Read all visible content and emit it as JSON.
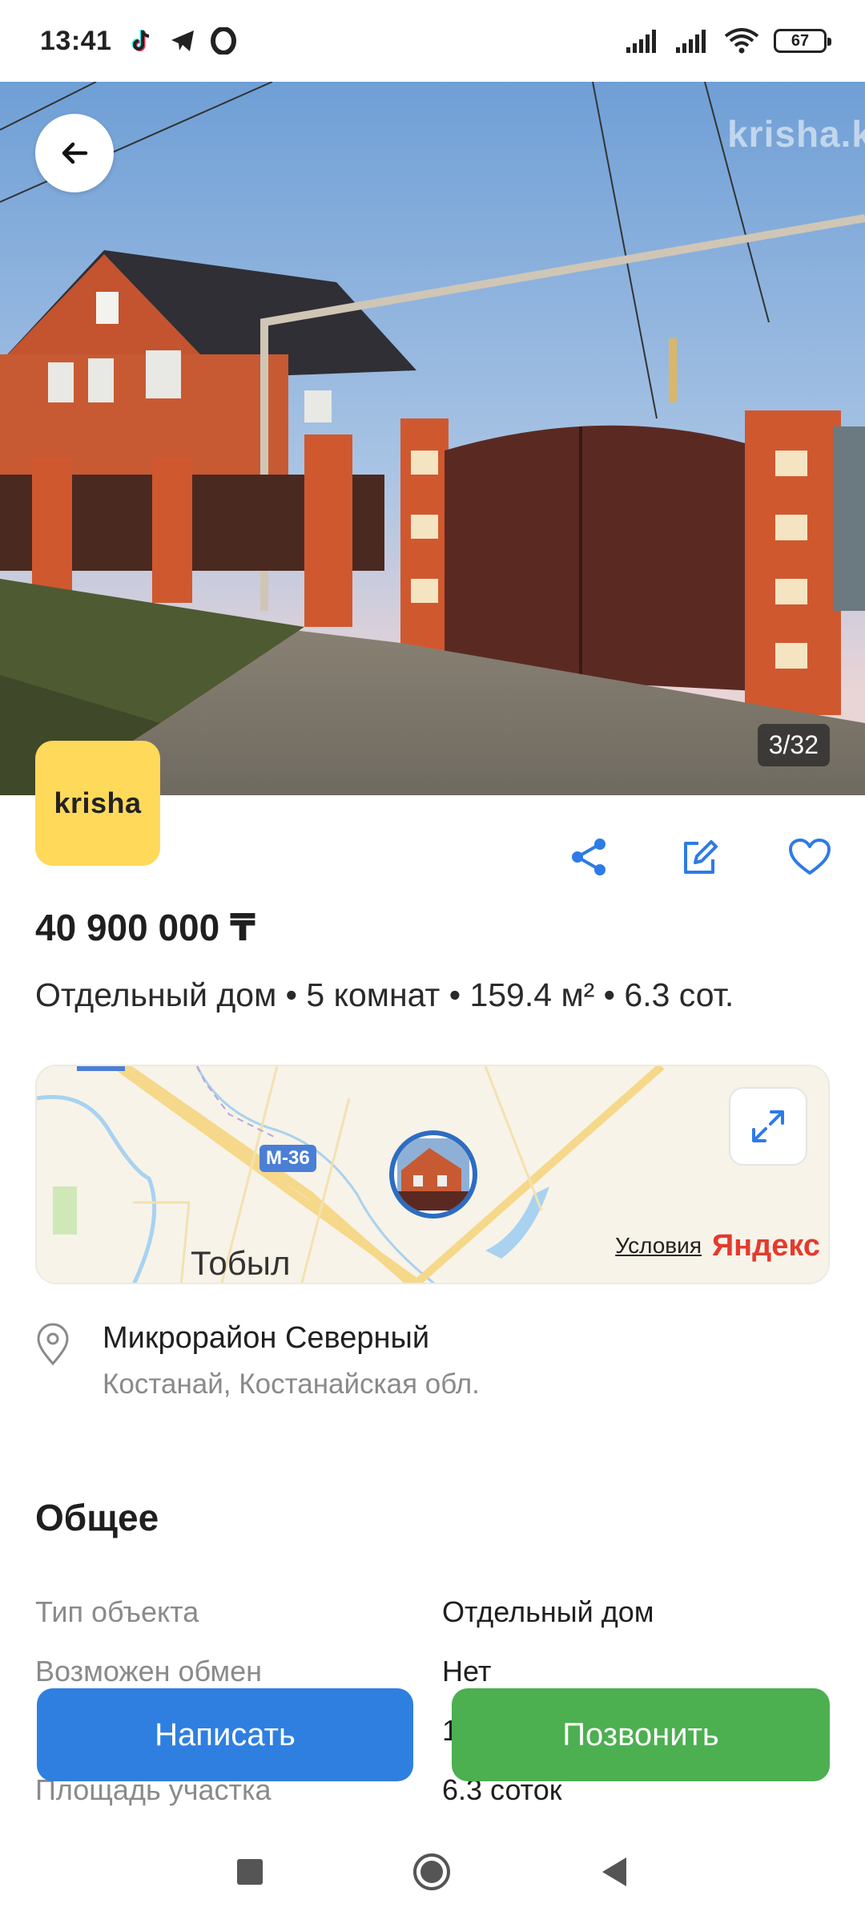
{
  "status_bar": {
    "time": "13:41",
    "battery": "67",
    "left_icons": [
      "tiktok-icon",
      "telegram-icon",
      "opera-icon"
    ],
    "right_icons": [
      "signal-icon",
      "signal-icon",
      "wifi-icon",
      "battery-icon"
    ]
  },
  "gallery": {
    "watermark": "krisha.k",
    "counter": "3/32"
  },
  "brand": {
    "logo_text": "krisha",
    "logo_color": "#ffd95a"
  },
  "actions": [
    "share-icon",
    "edit-icon",
    "heart-icon"
  ],
  "listing": {
    "price": "40 900 000 ₸",
    "subtitle": "Отдельный дом • 5 комнат • 159.4 м² • 6.3 сот."
  },
  "map": {
    "road_label": "М-36",
    "city_label": "Тобыл",
    "terms_label": "Условия",
    "provider": "Яндекс"
  },
  "address": {
    "main": "Микрорайон Северный",
    "sub": "Костанай, Костанайская обл."
  },
  "section": {
    "title": "Общее"
  },
  "properties": [
    {
      "label": "Тип объекта",
      "value": "Отдельный дом"
    },
    {
      "label": "Возможен обмен",
      "value": "Нет"
    },
    {
      "label": "",
      "value": "1"
    },
    {
      "label": "Площадь участка",
      "value": "6.3 соток"
    }
  ],
  "buttons": {
    "write": "Написать",
    "call": "Позвонить",
    "write_color": "#2f7fe0",
    "call_color": "#4caf50"
  },
  "nav": [
    "recents-icon",
    "home-icon",
    "back-icon"
  ]
}
